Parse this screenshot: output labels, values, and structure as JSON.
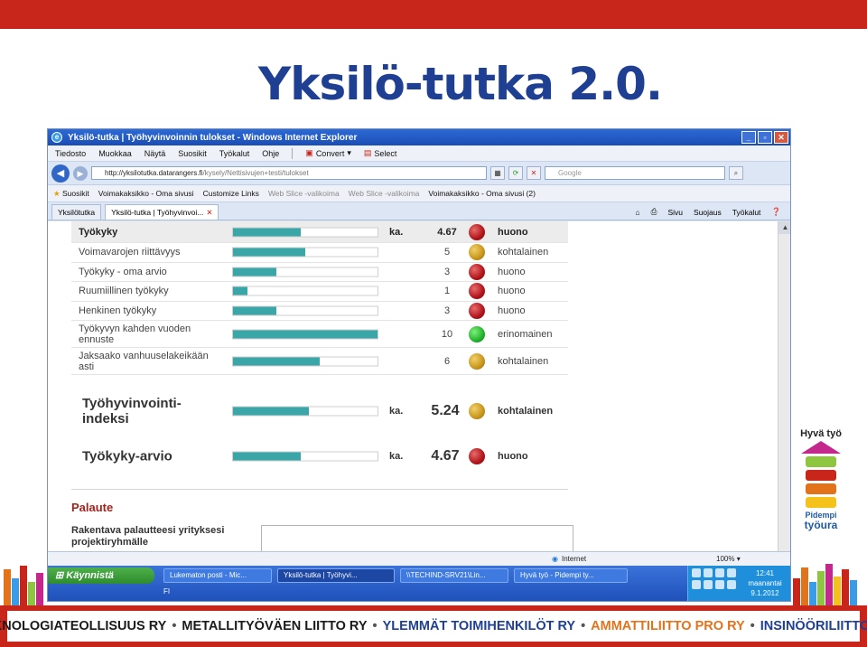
{
  "slide": {
    "title": "Yksilö-tutka 2.0.",
    "colors": {
      "title": "#1f3f93",
      "bars": "#c8261b",
      "accent_teal": "#3aa6a8"
    }
  },
  "browser": {
    "window_title": "Yksilö-tutka | Työhyvinvoinnin tulokset - Windows Internet Explorer",
    "menu": [
      "Tiedosto",
      "Muokkaa",
      "Näytä",
      "Suosikit",
      "Työkalut",
      "Ohje"
    ],
    "menu_tools": {
      "convert": "Convert",
      "select": "Select"
    },
    "address": {
      "host": "http://yksilotutka.datarangers.fi",
      "path": "/kysely/Nettisivujen+testi/tulokset"
    },
    "search_placeholder": "Google",
    "favorites": {
      "label": "Suosikit",
      "items": [
        "Voimakaksikko - Oma sivusi",
        "Customize Links",
        "Web Slice -valikoima",
        "Web Slice -valikoima",
        "Voimakaksikko - Oma sivusi (2)"
      ]
    },
    "tabs": [
      "Yksilötutka",
      "Yksilö-tutka | Työhyvinvoi..."
    ],
    "tab_tools": [
      "Sivu",
      "Suojaus",
      "Työkalut"
    ],
    "status": {
      "zone": "Internet",
      "zoom": "100%"
    }
  },
  "results": {
    "header": {
      "label": "Työkyky",
      "ka": "ka.",
      "value": "4.67",
      "rating": "huono",
      "status": "red",
      "fill": 0.467
    },
    "rows": [
      {
        "label": "Voimavarojen riittävyys",
        "value": "5",
        "rating": "kohtalainen",
        "status": "amber",
        "fill": 0.5
      },
      {
        "label": "Työkyky - oma arvio",
        "value": "3",
        "rating": "huono",
        "status": "red",
        "fill": 0.3
      },
      {
        "label": "Ruumiillinen työkyky",
        "value": "1",
        "rating": "huono",
        "status": "red",
        "fill": 0.1
      },
      {
        "label": "Henkinen työkyky",
        "value": "3",
        "rating": "huono",
        "status": "red",
        "fill": 0.3
      },
      {
        "label": "Työkyvyn kahden vuoden ennuste",
        "value": "10",
        "rating": "erinomainen",
        "status": "green",
        "fill": 1.0
      },
      {
        "label": "Jaksaako vanhuuselakeikään asti",
        "value": "6",
        "rating": "kohtalainen",
        "status": "amber",
        "fill": 0.6
      }
    ],
    "summary": [
      {
        "label": "Työhyvinvointi-indeksi",
        "ka": "ka.",
        "value": "5.24",
        "rating": "kohtalainen",
        "status": "amber",
        "fill": 0.524
      },
      {
        "label": "Työkyky-arvio",
        "ka": "ka.",
        "value": "4.67",
        "rating": "huono",
        "status": "red",
        "fill": 0.467
      }
    ],
    "feedback": {
      "heading": "Palaute",
      "label": "Rakentava palautteesi yrityksesi projektiryhmälle"
    }
  },
  "taskbar": {
    "start": "Käynnistä",
    "language": "FI",
    "tasks": [
      "Lukematon posti - Mic...",
      "Yksilö-tutka | Työhyvi...",
      "\\\\TECHIND-SRV21\\Lin...",
      "Hyvä työ - Pidempi ty..."
    ],
    "clock": {
      "time": "12:41",
      "day": "maanantai",
      "date": "9.1.2012"
    }
  },
  "logo": {
    "line1": "Hyvä työ",
    "line2": "Pidempi",
    "line3": "työura"
  },
  "footer": {
    "organizations": [
      {
        "name": "TEKNOLOGIATEOLLISUUS RY",
        "color": "#1a1a1a"
      },
      {
        "name": "METALLITYÖVÄEN LIITTO RY",
        "color": "#1a1a1a"
      },
      {
        "name": "YLEMMÄT TOIMIHENKILÖT RY",
        "color": "#1f3f93"
      },
      {
        "name": "AMMATTILIITTO PRO RY",
        "color": "#e2731b"
      },
      {
        "name": "INSINÖÖRILIITTO RY",
        "color": "#1f3f93"
      }
    ]
  }
}
